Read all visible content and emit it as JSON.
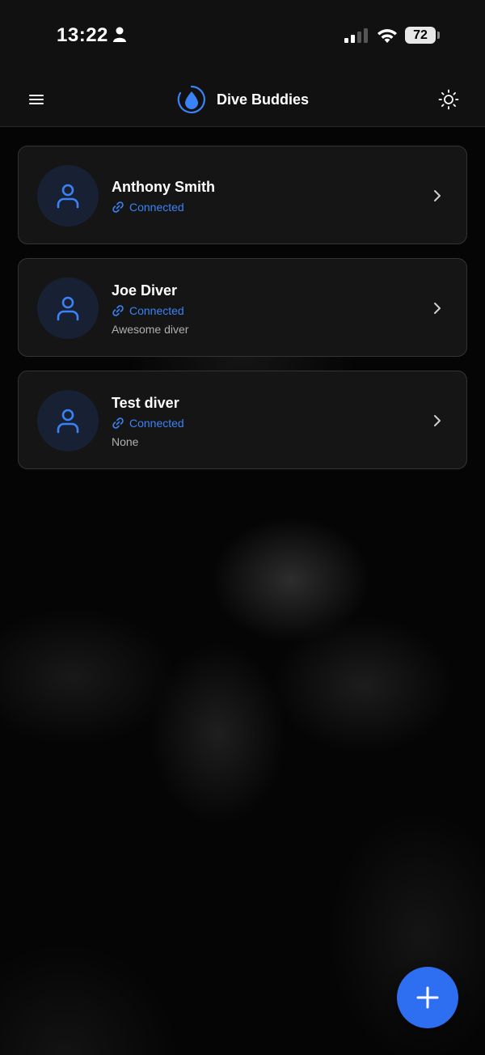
{
  "status_bar": {
    "time": "13:22",
    "battery": "72",
    "signal_strength": 0.5
  },
  "app_bar": {
    "title": "Dive Buddies",
    "menu_icon": "hamburger-menu-icon",
    "logo_icon": "water-drop-icon",
    "theme_icon": "sun-icon"
  },
  "buddies": [
    {
      "name": "Anthony Smith",
      "status": "Connected",
      "note": ""
    },
    {
      "name": "Joe Diver",
      "status": "Connected",
      "note": "Awesome diver"
    },
    {
      "name": "Test diver",
      "status": "Connected",
      "note": "None"
    }
  ],
  "fab": {
    "icon": "plus-icon"
  },
  "colors": {
    "accent": "#3b82f6",
    "fab": "#2d6ff0",
    "card_bg": "#161616",
    "avatar_bg": "#182033"
  }
}
